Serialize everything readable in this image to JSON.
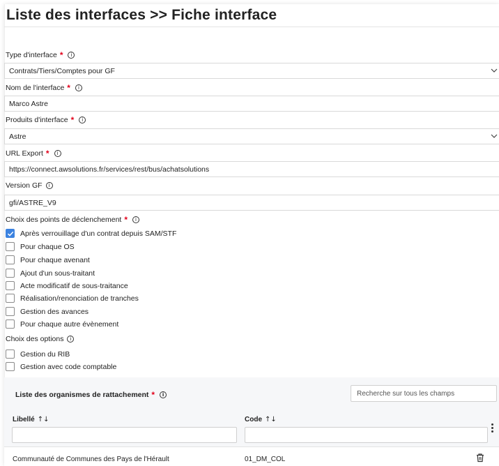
{
  "header": {
    "title": "Liste des interfaces >> Fiche interface"
  },
  "info_glyph": "i",
  "required_mark": "*",
  "fields": {
    "type": {
      "label": "Type d'interface",
      "value": "Contrats/Tiers/Comptes pour GF"
    },
    "name": {
      "label": "Nom de l'interface",
      "value": "Marco Astre"
    },
    "products": {
      "label": "Produits d'interface",
      "value": "Astre"
    },
    "url": {
      "label": "URL Export",
      "value": "https://connect.awsolutions.fr/services/rest/bus/achatsolutions"
    },
    "version": {
      "label": "Version GF",
      "value": "gfi/ASTRE_V9"
    }
  },
  "triggers": {
    "label": "Choix des points de déclenchement",
    "items": [
      {
        "label": "Après verrouillage d'un contrat depuis SAM/STF",
        "checked": true
      },
      {
        "label": "Pour chaque OS",
        "checked": false
      },
      {
        "label": "Pour chaque avenant",
        "checked": false
      },
      {
        "label": "Ajout d'un sous-traitant",
        "checked": false
      },
      {
        "label": "Acte modificatif de sous-traitance",
        "checked": false
      },
      {
        "label": "Réalisation/renonciation de tranches",
        "checked": false
      },
      {
        "label": "Gestion des avances",
        "checked": false
      },
      {
        "label": "Pour chaque autre évènement",
        "checked": false
      }
    ]
  },
  "options": {
    "label": "Choix des options",
    "items": [
      {
        "label": "Gestion du RIB",
        "checked": false
      },
      {
        "label": "Gestion avec code comptable",
        "checked": false
      }
    ]
  },
  "organisms": {
    "title": "Liste des organismes de rattachement",
    "search_placeholder": "Recherche sur tous les champs",
    "columns": {
      "libelle": "Libellé",
      "code": "Code"
    },
    "sort_glyph": "↑↓",
    "rows": [
      {
        "libelle": "Communauté de Communes des Pays de l'Hérault",
        "code": "01_DM_COL"
      }
    ]
  },
  "colors": {
    "accent": "#3b82e0",
    "required": "#e2001a"
  }
}
